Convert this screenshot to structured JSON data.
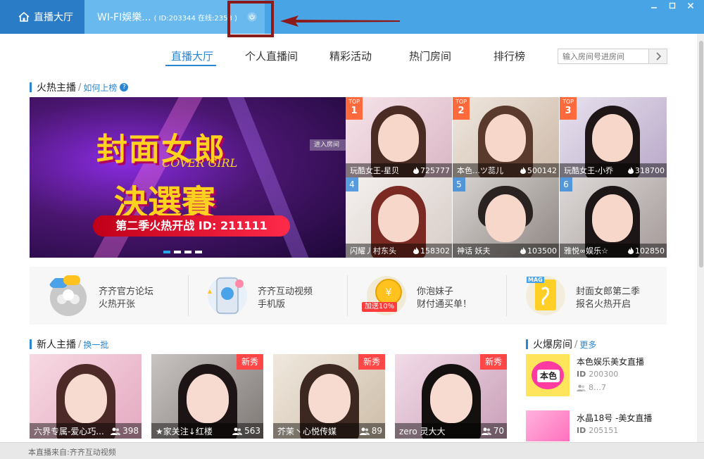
{
  "titlebar": {
    "home_tab": "直播大厅",
    "room_tab": "WI-FI娛樂...",
    "room_meta": "( ID:203344   在线:2353 )"
  },
  "nav": {
    "items": [
      "直播大厅",
      "个人直播间",
      "精彩活动",
      "热门房间",
      "排行榜"
    ],
    "search_placeholder": "输入房间号进房间"
  },
  "hot_section": {
    "title": "火热主播",
    "link": "如何上榜"
  },
  "banner": {
    "line1": "封面女郎",
    "line2": "COVER GIRL",
    "line3": "決選賽",
    "ribbon": "第二季火热开战 ID: 211111",
    "overlay_hint": "进入房间"
  },
  "top_anchors": [
    {
      "rank_label": "TOP",
      "rank": "1",
      "name": "玩酷女王-星贝",
      "score": "725777"
    },
    {
      "rank_label": "TOP",
      "rank": "2",
      "name": "本色…ツ蕊儿",
      "score": "500142"
    },
    {
      "rank_label": "TOP",
      "rank": "3",
      "name": "玩酷女王-小乔",
      "score": "318700"
    },
    {
      "rank": "4",
      "name": "闪耀丿村东头",
      "score": "158302"
    },
    {
      "rank": "5",
      "name": "神话     妖夫",
      "score": "103500"
    },
    {
      "rank": "6",
      "name": "雅悦∞娱乐☆",
      "score": "102850"
    }
  ],
  "features": [
    {
      "line1": "齐齐官方论坛",
      "line2": "火热开张"
    },
    {
      "line1": "齐齐互动视频",
      "line2": "手机版"
    },
    {
      "line1": "你泡妹子",
      "line2": "财付通买单！",
      "tag": "加送10%"
    },
    {
      "line1": "封面女郎第二季",
      "line2": "报名火热开启",
      "tag": "MAG"
    }
  ],
  "new_section": {
    "title": "新人主播",
    "link": "换一批"
  },
  "new_anchors": [
    {
      "name": "六界专属-爱心巧...",
      "count": "398"
    },
    {
      "name": "★家关注↓红楼",
      "count": "563",
      "badge": "新秀"
    },
    {
      "name": "芥茉丶心悦传媒",
      "count": "89",
      "badge": "新秀"
    },
    {
      "name": "zero 灵大大",
      "count": "70",
      "badge": "新秀"
    }
  ],
  "hot_rooms_section": {
    "title": "火爆房间",
    "link": "更多"
  },
  "hot_rooms": [
    {
      "name": "本色娱乐美女直播",
      "id_label": "ID",
      "id": "200300",
      "count": "8…7",
      "thumb_text": "本色"
    },
    {
      "name": "水晶18号 -美女直播",
      "id_label": "ID",
      "id": "205151"
    }
  ],
  "footer": {
    "text": "本直播来自:齐齐互动视频"
  },
  "colors": {
    "title_bar": "#49a4e6",
    "title_bar_active": "#2a7cc7",
    "accent": "#2a86d1",
    "badge_red": "#ff4747",
    "annotation": "#8b1a1a"
  }
}
